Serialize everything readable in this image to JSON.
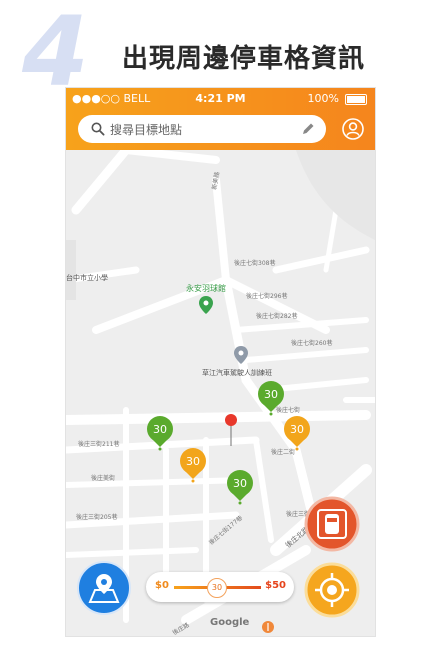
{
  "step_number": "4",
  "headline": "出現周邊停車格資訊",
  "status": {
    "carrier": "●●●○○ BELL",
    "time": "4:21 PM",
    "battery": "100%"
  },
  "search": {
    "placeholder": "搜尋目標地點"
  },
  "slider": {
    "min_label": "$0",
    "value_label": "30",
    "max_label": "$50",
    "value": 30
  },
  "map": {
    "places": [
      {
        "name": "永安羽球館",
        "kind": "poi-green"
      },
      {
        "name": "草江汽車駕駛人訓練班",
        "kind": "poi-gray"
      }
    ],
    "streets": [
      "新美路",
      "後庄七街308巷",
      "後庄七街296巷",
      "後庄七街282巷",
      "後庄七街260巷",
      "後庄七街",
      "後庄三街211巷",
      "後庄二街",
      "後庄三街205巷",
      "後庄三街",
      "後庄七街177巷",
      "後庄北路",
      "後庄路",
      "後庄美街"
    ],
    "school": "台中市立小學"
  },
  "pins": [
    {
      "label": "30",
      "color": "#5aaa2d"
    },
    {
      "label": "30",
      "color": "#5aaa2d"
    },
    {
      "label": "30",
      "color": "#f2a51b"
    },
    {
      "label": "30",
      "color": "#f2a51b"
    },
    {
      "label": "30",
      "color": "#5aaa2d"
    }
  ],
  "colors": {
    "accent": "#f5921d",
    "parking_green": "#5aaa2d",
    "parking_orange": "#f2a51b",
    "map_blue_button": "#1f7fe0",
    "parking_button": "#e3552b"
  },
  "brand": "Google"
}
